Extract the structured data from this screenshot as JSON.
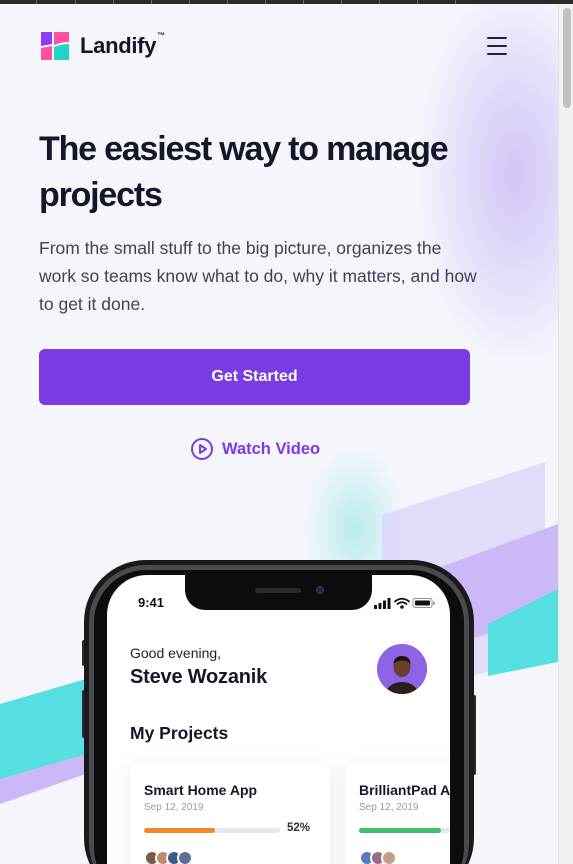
{
  "brand": {
    "name": "Landify",
    "trademark": "™"
  },
  "header": {
    "menu_icon": "hamburger-menu-icon"
  },
  "hero": {
    "title": "The easiest way to manage projects",
    "subtitle": "From the small stuff to the big picture, organizes the work so teams know what to do, why it matters, and how to get it done.",
    "cta_label": "Get Started",
    "watch_label": "Watch Video",
    "watch_icon": "play-circle-icon"
  },
  "phone": {
    "status_time": "9:41",
    "status_icons": [
      "signal-icon",
      "wifi-icon",
      "battery-icon"
    ],
    "greeting": "Good evening,",
    "user_name": "Steve Wozanik",
    "section_title": "My Projects",
    "projects": [
      {
        "name": "Smart Home App",
        "date": "Sep 12, 2019",
        "progress_label": "52%",
        "progress": 0.52,
        "color": "#f5862b"
      },
      {
        "name": "BrilliantPad A",
        "date": "Sep 12, 2019",
        "progress_label": "",
        "progress": 0.6,
        "color": "#3fc068"
      }
    ]
  },
  "colors": {
    "accent": "#7b3be3",
    "teal": "#55dfe0",
    "lavender": "#cdbdf6",
    "text_dark": "#14172a",
    "text_body": "#3e4354"
  }
}
